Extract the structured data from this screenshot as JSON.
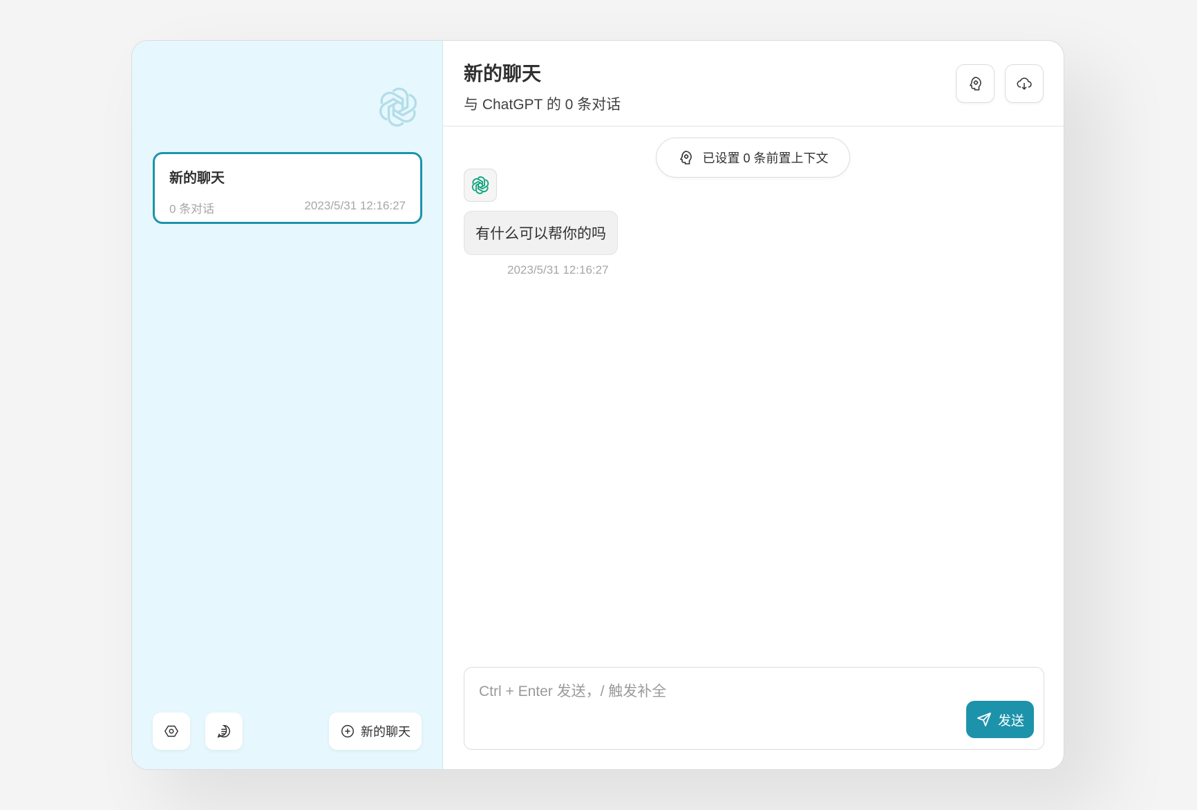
{
  "sidebar": {
    "chat_items": [
      {
        "title": "新的聊天",
        "count": "0 条对话",
        "time": "2023/5/31 12:16:27"
      }
    ],
    "new_chat_label": "新的聊天"
  },
  "header": {
    "title": "新的聊天",
    "subtitle": "与 ChatGPT 的 0 条对话"
  },
  "context": {
    "label": "已设置 0 条前置上下文"
  },
  "messages": [
    {
      "role": "assistant",
      "text": "有什么可以帮你的吗",
      "time": "2023/5/31 12:16:27"
    }
  ],
  "composer": {
    "placeholder": "Ctrl + Enter 发送，/ 触发补全",
    "value": "",
    "send_label": "发送"
  },
  "colors": {
    "accent": "#1d93ab",
    "sidebar_bg": "#e6f7fd",
    "logo": "#10a37f"
  },
  "icons": [
    "openai-logo-icon",
    "gear-icon",
    "note-icon",
    "plus-circle-icon",
    "brain-icon",
    "download-icon",
    "send-icon"
  ]
}
